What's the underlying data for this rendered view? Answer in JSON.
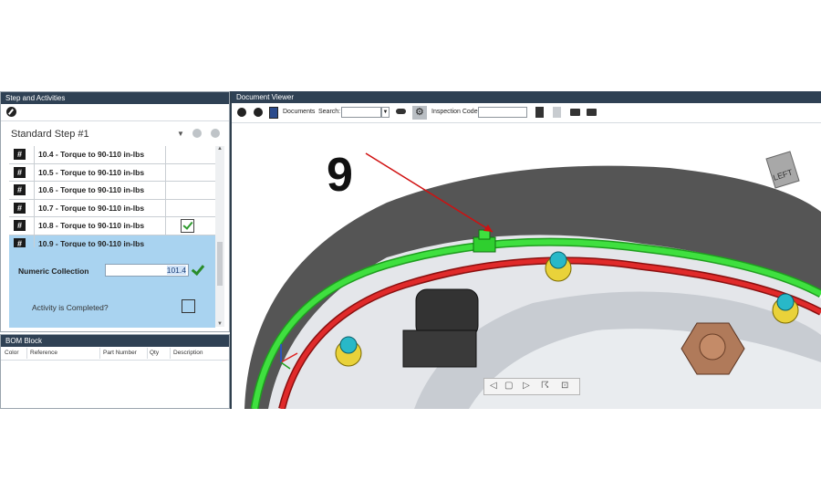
{
  "steps_panel": {
    "header": "Step and Activities",
    "step_title": "Standard Step #1",
    "rows": [
      {
        "label": "10.4 - Torque to 90-110 in-lbs",
        "checked": false
      },
      {
        "label": "10.5 - Torque to 90-110 in-lbs",
        "checked": false
      },
      {
        "label": "10.6 - Torque to 90-110 in-lbs",
        "checked": false
      },
      {
        "label": "10.7 - Torque to 90-110 in-lbs",
        "checked": false
      },
      {
        "label": "10.8 - Torque to 90-110 in-lbs",
        "checked": true
      },
      {
        "label": "10.9 - Torque to 90-110 in-lbs",
        "checked": false,
        "selected": true
      }
    ],
    "numeric_label": "Numeric Collection",
    "numeric_value": "101.4",
    "activity_label": "Activity is Completed?"
  },
  "bom": {
    "header": "BOM Block",
    "columns": [
      "Color",
      "Reference",
      "Part Number",
      "Qty",
      "Description"
    ]
  },
  "viewer": {
    "header": "Document Viewer",
    "documents_label": "Documents",
    "search_label": "Search:",
    "search_value": "",
    "inspection_label": "Inspection Code",
    "inspection_value": "",
    "callout": "9",
    "cube_label": "LEFT"
  },
  "colors": {
    "header_bg": "#2f4154",
    "selected_row": "#a9d3f0",
    "green_pipe": "#2fd12f",
    "red_pipe": "#d9201f"
  }
}
